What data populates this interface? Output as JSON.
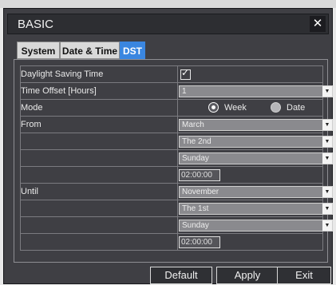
{
  "window": {
    "title": "BASIC",
    "close_symbol": "✕"
  },
  "tabs": [
    {
      "label": "System",
      "active": false
    },
    {
      "label": "Date & Time",
      "active": false
    },
    {
      "label": "DST",
      "active": true
    }
  ],
  "dst": {
    "daylight_saving": {
      "label": "Daylight Saving Time",
      "checked": true
    },
    "time_offset": {
      "label": "Time Offset [Hours]",
      "value": "1"
    },
    "mode": {
      "label": "Mode",
      "options": [
        "Week",
        "Date"
      ],
      "selected": "Week"
    },
    "from": {
      "label": "From",
      "month": "March",
      "week": "The 2nd",
      "day": "Sunday",
      "time": "02:00:00"
    },
    "until": {
      "label": "Until",
      "month": "November",
      "week": "The 1st",
      "day": "Sunday",
      "time": "02:00:00"
    }
  },
  "buttons": {
    "default": "Default",
    "apply": "Apply",
    "exit": "Exit"
  },
  "colors": {
    "active_tab": "#3a86e0",
    "window_bg": "#3f3f44",
    "title_bg": "#2d2e32"
  }
}
